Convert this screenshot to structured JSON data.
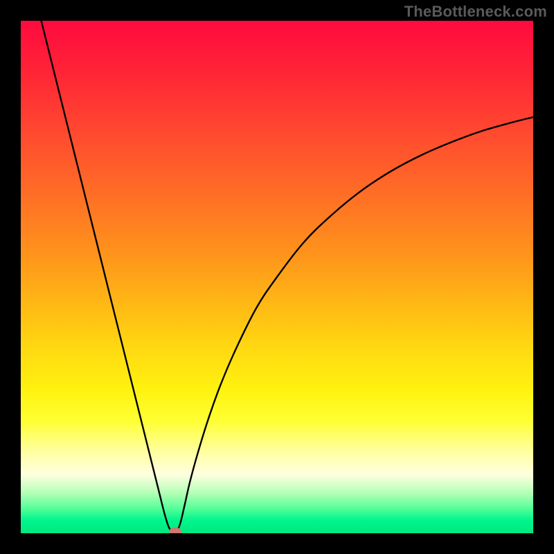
{
  "watermark": "TheBottleneck.com",
  "chart_data": {
    "type": "line",
    "title": "",
    "xlabel": "",
    "ylabel": "",
    "xlim": [
      0,
      100
    ],
    "ylim": [
      0,
      100
    ],
    "grid": false,
    "legend": false,
    "background_gradient": {
      "top_color": "#ff0a3f",
      "mid_color": "#ffd911",
      "bottom_color": "#00e880",
      "description": "vertical rainbow gradient, red at top through orange and yellow to green at bottom"
    },
    "series": [
      {
        "name": "bottleneck-curve",
        "color": "#000000",
        "x": [
          4,
          6,
          8,
          10,
          12,
          14,
          16,
          18,
          20,
          22,
          24,
          26,
          27,
          28,
          28.8,
          29.4,
          30,
          30.6,
          31.2,
          32,
          33,
          34.5,
          36.5,
          39,
          42,
          46,
          50,
          55,
          60,
          66,
          72,
          78,
          84,
          90,
          96,
          100
        ],
        "y": [
          100,
          92,
          84,
          76,
          68,
          60,
          52,
          44,
          36,
          28,
          20,
          12,
          8,
          4,
          1.4,
          0.4,
          0,
          0.6,
          2.2,
          5.6,
          10,
          15.5,
          22,
          29,
          36,
          44,
          50,
          56.5,
          61.5,
          66.5,
          70.5,
          73.7,
          76.3,
          78.5,
          80.2,
          81.2
        ]
      }
    ],
    "markers": [
      {
        "name": "optimal-point",
        "x": 30.2,
        "y": 0.3,
        "color": "#c77c6f"
      }
    ]
  }
}
